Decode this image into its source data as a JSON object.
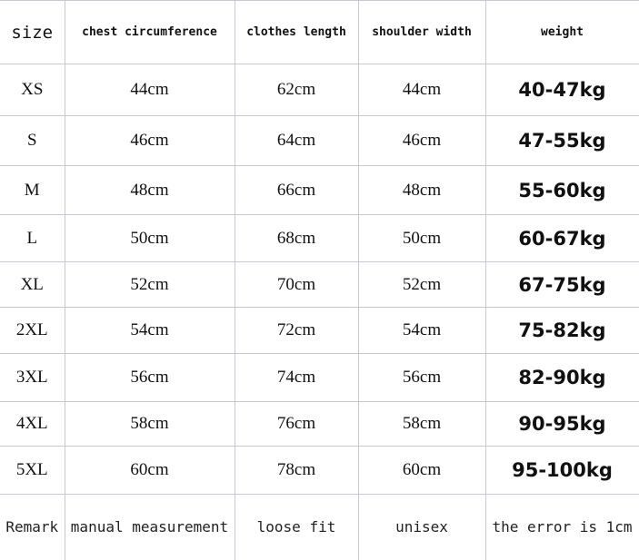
{
  "table": {
    "headers": {
      "size": "size",
      "chest": "chest circumference",
      "length": "clothes length",
      "shoulder": "shoulder width",
      "weight": "weight"
    },
    "rows": [
      {
        "size": "XS",
        "chest": "44cm",
        "length": "62cm",
        "shoulder": "44cm",
        "weight": "40-47kg"
      },
      {
        "size": "S",
        "chest": "46cm",
        "length": "64cm",
        "shoulder": "46cm",
        "weight": "47-55kg"
      },
      {
        "size": "M",
        "chest": "48cm",
        "length": "66cm",
        "shoulder": "48cm",
        "weight": "55-60kg"
      },
      {
        "size": "L",
        "chest": "50cm",
        "length": "68cm",
        "shoulder": "50cm",
        "weight": "60-67kg"
      },
      {
        "size": "XL",
        "chest": "52cm",
        "length": "70cm",
        "shoulder": "52cm",
        "weight": "67-75kg"
      },
      {
        "size": "2XL",
        "chest": "54cm",
        "length": "72cm",
        "shoulder": "54cm",
        "weight": "75-82kg"
      },
      {
        "size": "3XL",
        "chest": "56cm",
        "length": "74cm",
        "shoulder": "56cm",
        "weight": "82-90kg"
      },
      {
        "size": "4XL",
        "chest": "58cm",
        "length": "76cm",
        "shoulder": "58cm",
        "weight": "90-95kg"
      },
      {
        "size": "5XL",
        "chest": "60cm",
        "length": "78cm",
        "shoulder": "60cm",
        "weight": "95-100kg"
      }
    ],
    "remark": {
      "label": "Remark",
      "chest": "manual measurement",
      "length": "loose fit",
      "shoulder": "unisex",
      "weight": "the error is 1cm"
    }
  },
  "colors": {
    "grid_line": "#c8c8d0",
    "selected_top_border": "#3cb08a",
    "text": "#111111"
  }
}
